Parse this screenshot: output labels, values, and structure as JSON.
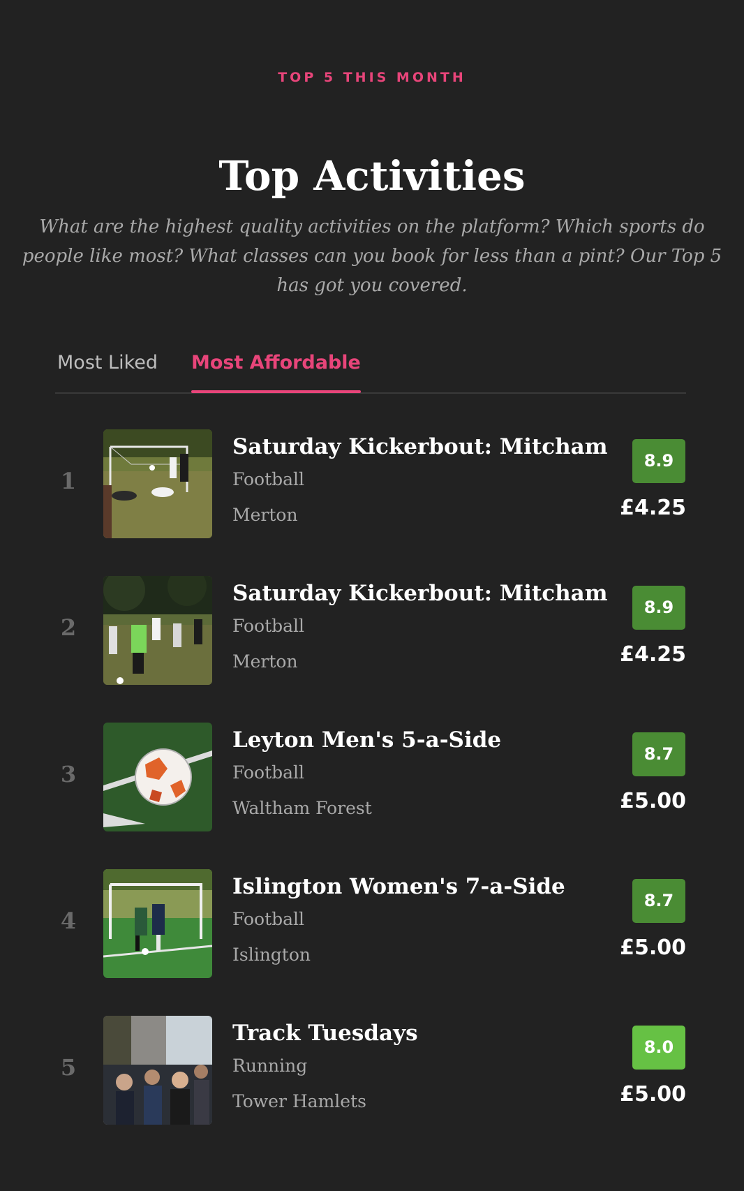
{
  "header": {
    "eyebrow": "TOP 5 THIS MONTH",
    "title": "Top Activities",
    "subtitle": "What are the highest quality activities on the platform? Which sports do people like most? What classes can you book for less than a pint? Our Top 5 has got you covered."
  },
  "tabs": [
    {
      "label": "Most Liked",
      "active": false
    },
    {
      "label": "Most Affordable",
      "active": true
    }
  ],
  "colors": {
    "accent": "#e8457a",
    "background": "#222222",
    "score_green": "#4a8c34",
    "score_bright_green": "#66c144"
  },
  "activities": [
    {
      "rank": "1",
      "name": "Saturday Kickerbout: Mitcham",
      "sport": "Football",
      "area": "Merton",
      "score": "8.9",
      "price": "£4.25",
      "image": "football-goalmouth-photo"
    },
    {
      "rank": "2",
      "name": "Saturday Kickerbout: Mitcham",
      "sport": "Football",
      "area": "Merton",
      "score": "8.9",
      "price": "£4.25",
      "image": "football-players-park-photo"
    },
    {
      "rank": "3",
      "name": "Leyton Men's 5-a-Side",
      "sport": "Football",
      "area": "Waltham Forest",
      "score": "8.7",
      "price": "£5.00",
      "image": "football-ball-on-grass-photo"
    },
    {
      "rank": "4",
      "name": "Islington Women's 7-a-Side",
      "sport": "Football",
      "area": "Islington",
      "score": "8.7",
      "price": "£5.00",
      "image": "womens-football-match-photo"
    },
    {
      "rank": "5",
      "name": "Track Tuesdays",
      "sport": "Running",
      "area": "Tower Hamlets",
      "score": "8.0",
      "price": "£5.00",
      "image": "running-group-crowd-photo"
    }
  ]
}
